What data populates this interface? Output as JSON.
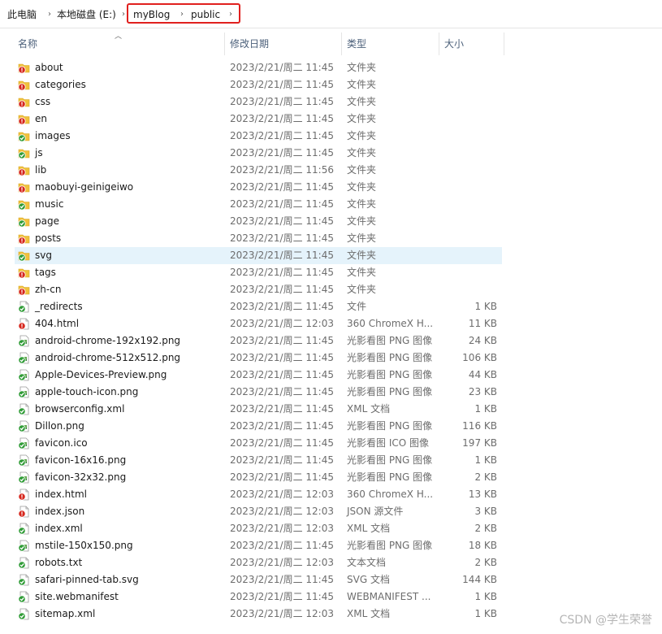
{
  "breadcrumb": {
    "items": [
      "此电脑",
      "本地磁盘 (E:)",
      "myBlog",
      "public"
    ]
  },
  "columns": {
    "name": "名称",
    "date": "修改日期",
    "type": "类型",
    "size": "大小"
  },
  "status_colors": {
    "synced": "#2e9b35",
    "error": "#d6281e",
    "folder": "#f0c13c"
  },
  "rows": [
    {
      "name": "about",
      "date": "2023/2/21/周二 11:45",
      "type": "文件夹",
      "size": "",
      "kind": "folder",
      "status": "error"
    },
    {
      "name": "categories",
      "date": "2023/2/21/周二 11:45",
      "type": "文件夹",
      "size": "",
      "kind": "folder",
      "status": "error"
    },
    {
      "name": "css",
      "date": "2023/2/21/周二 11:45",
      "type": "文件夹",
      "size": "",
      "kind": "folder",
      "status": "error"
    },
    {
      "name": "en",
      "date": "2023/2/21/周二 11:45",
      "type": "文件夹",
      "size": "",
      "kind": "folder",
      "status": "error"
    },
    {
      "name": "images",
      "date": "2023/2/21/周二 11:45",
      "type": "文件夹",
      "size": "",
      "kind": "folder",
      "status": "synced"
    },
    {
      "name": "js",
      "date": "2023/2/21/周二 11:45",
      "type": "文件夹",
      "size": "",
      "kind": "folder",
      "status": "synced"
    },
    {
      "name": "lib",
      "date": "2023/2/21/周二 11:56",
      "type": "文件夹",
      "size": "",
      "kind": "folder",
      "status": "error"
    },
    {
      "name": "maobuyi-geinigeiwo",
      "date": "2023/2/21/周二 11:45",
      "type": "文件夹",
      "size": "",
      "kind": "folder",
      "status": "error"
    },
    {
      "name": "music",
      "date": "2023/2/21/周二 11:45",
      "type": "文件夹",
      "size": "",
      "kind": "folder",
      "status": "synced"
    },
    {
      "name": "page",
      "date": "2023/2/21/周二 11:45",
      "type": "文件夹",
      "size": "",
      "kind": "folder",
      "status": "synced"
    },
    {
      "name": "posts",
      "date": "2023/2/21/周二 11:45",
      "type": "文件夹",
      "size": "",
      "kind": "folder",
      "status": "error"
    },
    {
      "name": "svg",
      "date": "2023/2/21/周二 11:45",
      "type": "文件夹",
      "size": "",
      "kind": "folder",
      "status": "synced",
      "selected": true
    },
    {
      "name": "tags",
      "date": "2023/2/21/周二 11:45",
      "type": "文件夹",
      "size": "",
      "kind": "folder",
      "status": "error"
    },
    {
      "name": "zh-cn",
      "date": "2023/2/21/周二 11:45",
      "type": "文件夹",
      "size": "",
      "kind": "folder",
      "status": "error"
    },
    {
      "name": "_redirects",
      "date": "2023/2/21/周二 11:45",
      "type": "文件",
      "size": "1 KB",
      "kind": "file",
      "status": "synced"
    },
    {
      "name": "404.html",
      "date": "2023/2/21/周二 12:03",
      "type": "360 ChromeX H...",
      "size": "11 KB",
      "kind": "file",
      "status": "error"
    },
    {
      "name": "android-chrome-192x192.png",
      "date": "2023/2/21/周二 11:45",
      "type": "光影看图 PNG 图像",
      "size": "24 KB",
      "kind": "image",
      "status": "synced"
    },
    {
      "name": "android-chrome-512x512.png",
      "date": "2023/2/21/周二 11:45",
      "type": "光影看图 PNG 图像",
      "size": "106 KB",
      "kind": "image",
      "status": "synced"
    },
    {
      "name": "Apple-Devices-Preview.png",
      "date": "2023/2/21/周二 11:45",
      "type": "光影看图 PNG 图像",
      "size": "44 KB",
      "kind": "image",
      "status": "synced"
    },
    {
      "name": "apple-touch-icon.png",
      "date": "2023/2/21/周二 11:45",
      "type": "光影看图 PNG 图像",
      "size": "23 KB",
      "kind": "image",
      "status": "synced"
    },
    {
      "name": "browserconfig.xml",
      "date": "2023/2/21/周二 11:45",
      "type": "XML 文档",
      "size": "1 KB",
      "kind": "file",
      "status": "synced"
    },
    {
      "name": "Dillon.png",
      "date": "2023/2/21/周二 11:45",
      "type": "光影看图 PNG 图像",
      "size": "116 KB",
      "kind": "image",
      "status": "synced"
    },
    {
      "name": "favicon.ico",
      "date": "2023/2/21/周二 11:45",
      "type": "光影看图 ICO 图像",
      "size": "197 KB",
      "kind": "image",
      "status": "synced"
    },
    {
      "name": "favicon-16x16.png",
      "date": "2023/2/21/周二 11:45",
      "type": "光影看图 PNG 图像",
      "size": "1 KB",
      "kind": "image",
      "status": "synced"
    },
    {
      "name": "favicon-32x32.png",
      "date": "2023/2/21/周二 11:45",
      "type": "光影看图 PNG 图像",
      "size": "2 KB",
      "kind": "image",
      "status": "synced"
    },
    {
      "name": "index.html",
      "date": "2023/2/21/周二 12:03",
      "type": "360 ChromeX H...",
      "size": "13 KB",
      "kind": "file",
      "status": "error"
    },
    {
      "name": "index.json",
      "date": "2023/2/21/周二 12:03",
      "type": "JSON 源文件",
      "size": "3 KB",
      "kind": "file",
      "status": "error"
    },
    {
      "name": "index.xml",
      "date": "2023/2/21/周二 12:03",
      "type": "XML 文档",
      "size": "2 KB",
      "kind": "file",
      "status": "synced"
    },
    {
      "name": "mstile-150x150.png",
      "date": "2023/2/21/周二 11:45",
      "type": "光影看图 PNG 图像",
      "size": "18 KB",
      "kind": "image",
      "status": "synced"
    },
    {
      "name": "robots.txt",
      "date": "2023/2/21/周二 12:03",
      "type": "文本文档",
      "size": "2 KB",
      "kind": "file",
      "status": "synced"
    },
    {
      "name": "safari-pinned-tab.svg",
      "date": "2023/2/21/周二 11:45",
      "type": "SVG 文档",
      "size": "144 KB",
      "kind": "file",
      "status": "synced"
    },
    {
      "name": "site.webmanifest",
      "date": "2023/2/21/周二 11:45",
      "type": "WEBMANIFEST ...",
      "size": "1 KB",
      "kind": "file",
      "status": "synced"
    },
    {
      "name": "sitemap.xml",
      "date": "2023/2/21/周二 12:03",
      "type": "XML 文档",
      "size": "1 KB",
      "kind": "file",
      "status": "synced"
    }
  ],
  "watermark": "CSDN @学生荣誉"
}
